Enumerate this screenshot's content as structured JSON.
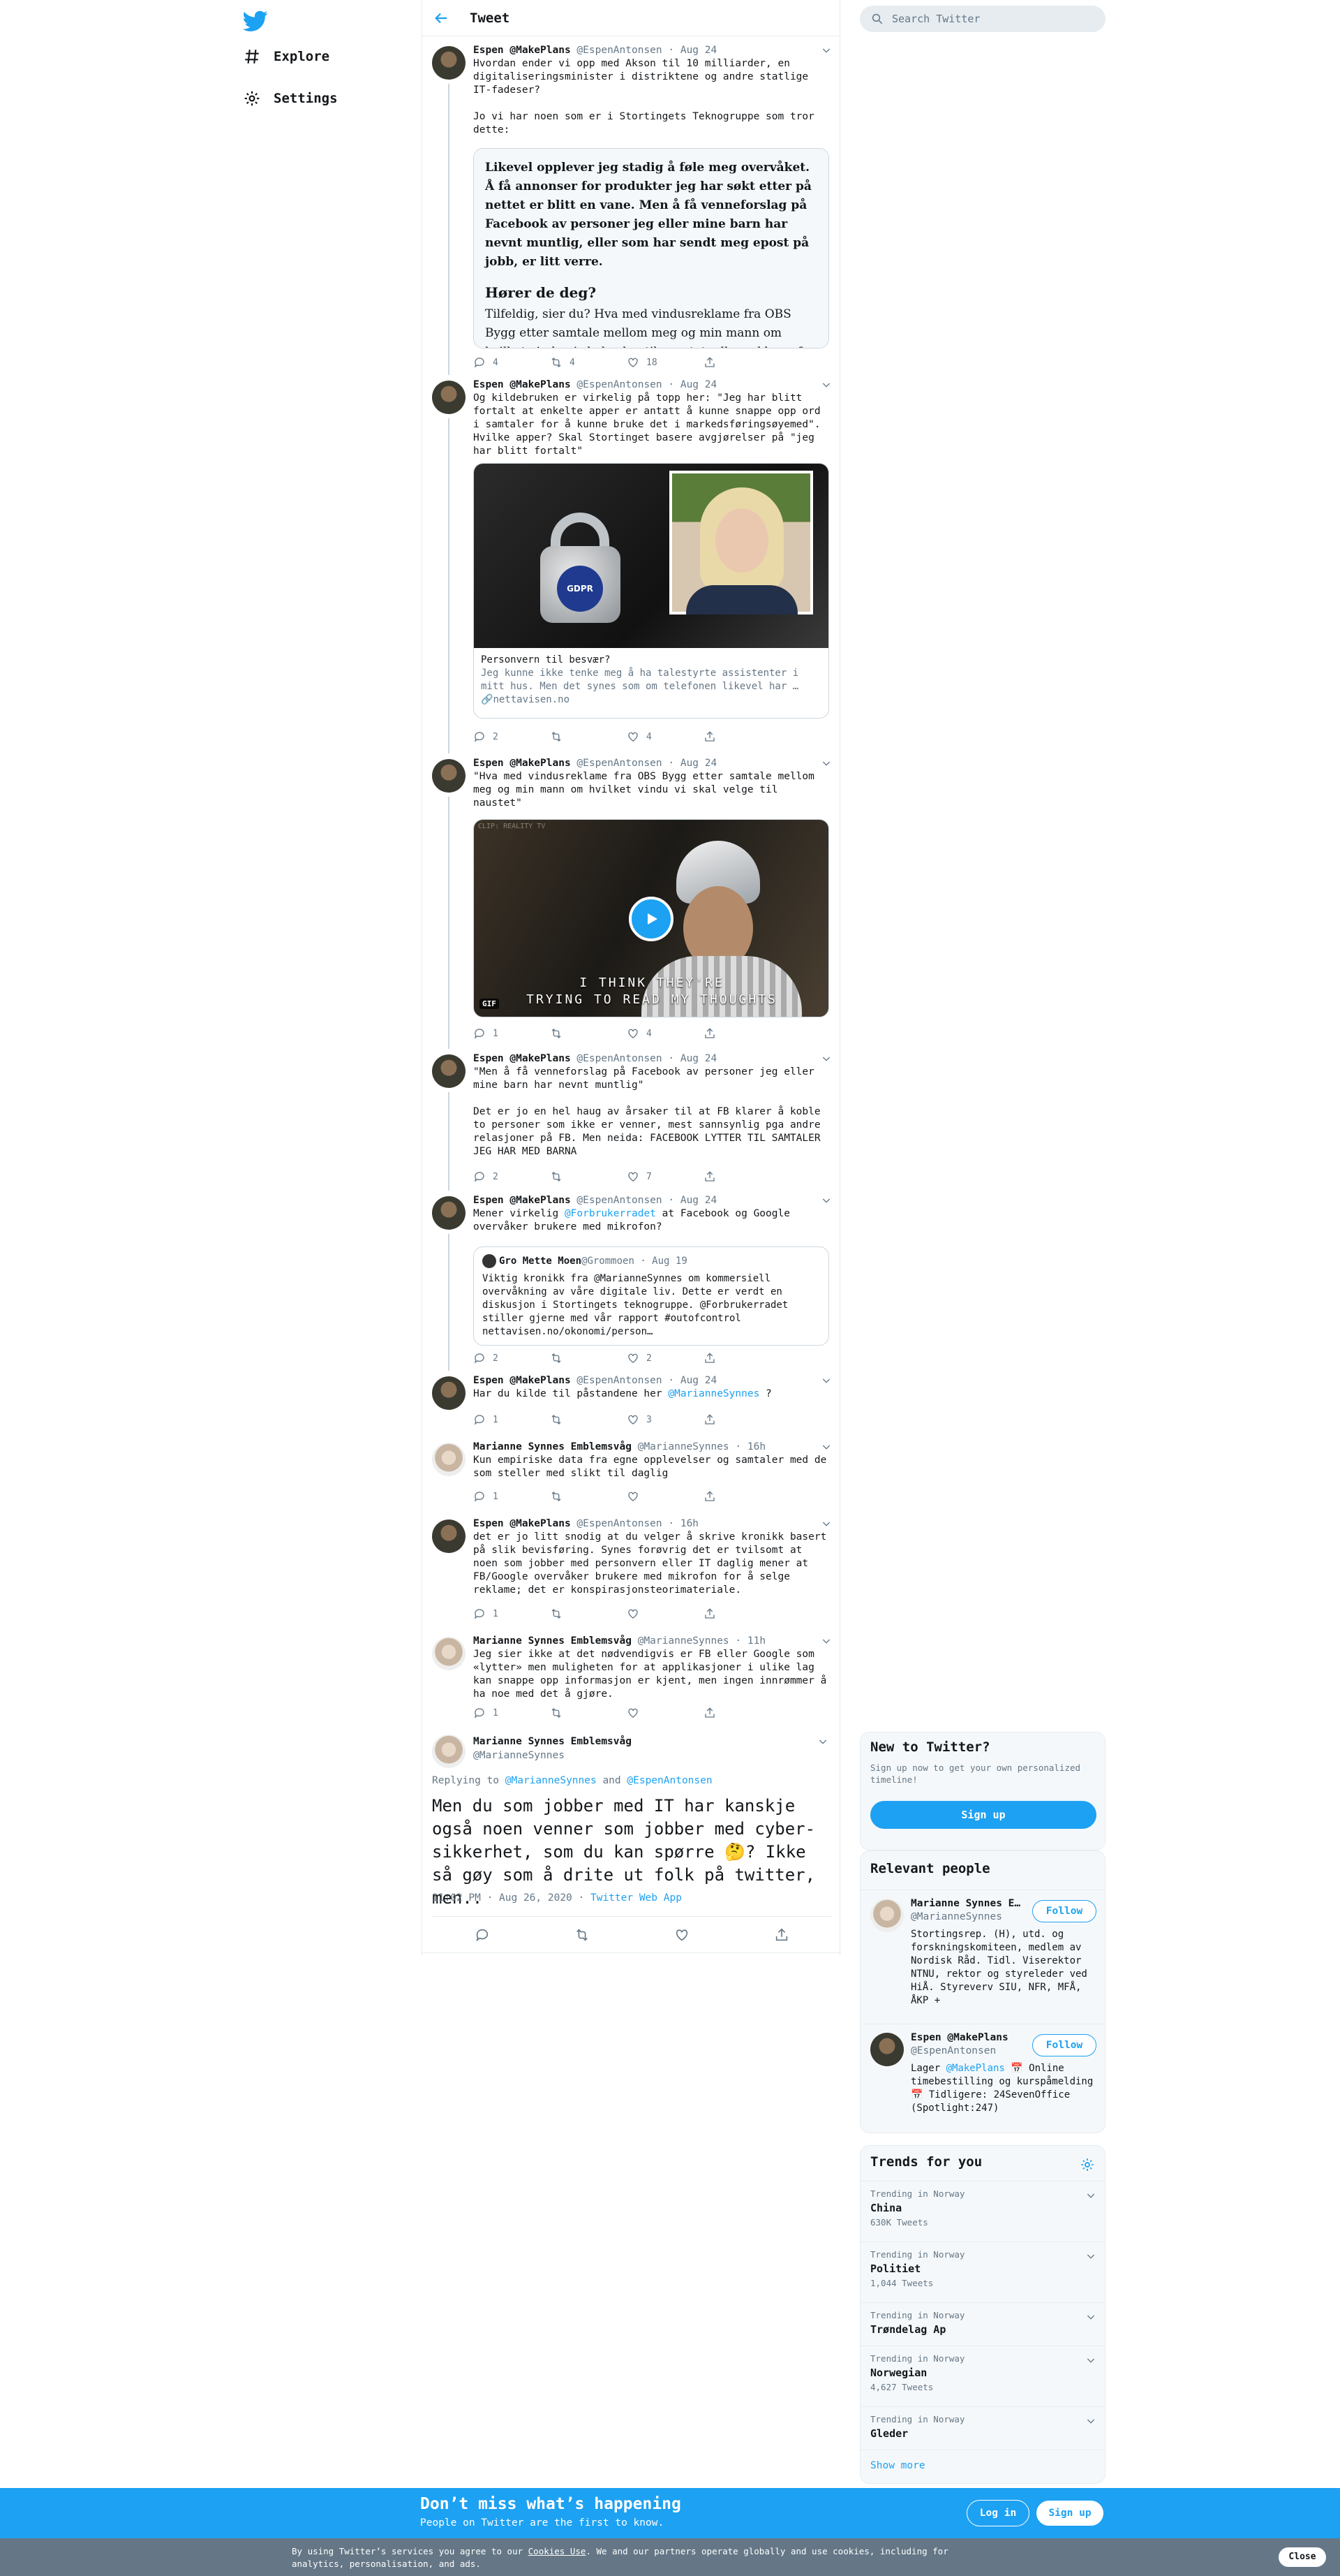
{
  "nav": {
    "explore": "Explore",
    "settings": "Settings"
  },
  "header": {
    "title": "Tweet"
  },
  "search": {
    "placeholder": "Search Twitter"
  },
  "tweets": [
    {
      "name": "Espen @MakePlans",
      "handle": "@EspenAntonsen",
      "time": "· Aug 24",
      "text": "Hvordan ender vi opp med Akson til 10 milliarder, en digitaliseringsminister i distriktene og andre statlige IT-fadeser?\n\nJo vi har noen som er i Stortingets Teknogruppe som tror dette:",
      "article_bold": "Likevel opplever jeg stadig å føle meg overvåket. Å få annonser for produkter jeg har søkt etter på nettet er blitt en vane. Men å få venneforslag på Facebook av personer jeg eller mine barn har nevnt muntlig, eller som har sendt meg epost på jobb, er litt verre.",
      "article_heading": "Hører de deg?",
      "article_text": "Tilfeldig, sier du? Hva med vindusreklame fra OBS Bygg etter samtale mellom meg og min mann om hvilket vindu vi skal velge til naustet, eller reklame for Disney når jeg",
      "replies": "4",
      "retweets": "4",
      "likes": "18"
    },
    {
      "name": "Espen @MakePlans",
      "handle": "@EspenAntonsen",
      "time": "· Aug 24",
      "text": "Og kildebruken er virkelig på topp her: \"Jeg har blitt fortalt at enkelte apper er antatt å kunne snappe opp ord i samtaler for å kunne bruke det i markedsføringsøyemed\". Hvilke apper? Skal Stortinget basere avgjørelser på \"jeg har blitt fortalt\"",
      "card_title": "Personvern til besvær?",
      "card_desc": "Jeg kunne ikke tenke meg å ha talestyrte assistenter i mitt hus. Men det synes som om telefonen likevel har …",
      "card_domain": "nettavisen.no",
      "card_badge": "GDPR",
      "replies": "2",
      "retweets": "",
      "likes": "4"
    },
    {
      "name": "Espen @MakePlans",
      "handle": "@EspenAntonsen",
      "time": "· Aug 24",
      "text": "\"Hva med vindusreklame fra OBS Bygg etter samtale mellom meg og min mann om hvilket vindu vi skal velge til naustet\"",
      "gif_caption_1": "I THINK THEY'RE",
      "gif_caption_2": "TRYING TO READ MY THOUGHTS",
      "gif_badge": "GIF",
      "gif_watermark": "CLIP: REALITY TV",
      "replies": "1",
      "retweets": "",
      "likes": "4"
    },
    {
      "name": "Espen @MakePlans",
      "handle": "@EspenAntonsen",
      "time": "· Aug 24",
      "text": "\"Men å få venneforslag på Facebook av personer jeg eller mine barn har nevnt muntlig\"\n\nDet er jo en hel haug av årsaker til at FB klarer å koble to personer som ikke er venner, mest sannsynlig pga andre relasjoner på FB. Men neida: FACEBOOK LYTTER TIL SAMTALER JEG HAR MED BARNA",
      "replies": "2",
      "retweets": "",
      "likes": "7"
    },
    {
      "name": "Espen @MakePlans",
      "handle": "@EspenAntonsen",
      "time": "· Aug 24",
      "text_pre": "Mener virkelig ",
      "mention": "@Forbrukerradet",
      "text_post": " at Facebook og Google overvåker brukere med mikrofon?",
      "quote_name": "Gro Mette Moen",
      "quote_handle": "@Grommoen",
      "quote_time": "· Aug 19",
      "quote_text": "Viktig kronikk fra @MarianneSynnes om kommersiell overvåkning av våre digitale liv. Dette er verdt en diskusjon i Stortingets teknogruppe. @Forbrukerradet stiller gjerne med vår rapport #outofcontrol nettavisen.no/okonomi/person…",
      "replies": "2",
      "retweets": "",
      "likes": "2"
    },
    {
      "name": "Espen @MakePlans",
      "handle": "@EspenAntonsen",
      "time": "· Aug 24",
      "text_pre": "Har du kilde til påstandene her ",
      "mention": "@MarianneSynnes",
      "text_post": " ?",
      "replies": "1",
      "retweets": "",
      "likes": "3"
    },
    {
      "name": "Marianne Synnes Emblemsvåg",
      "handle": "@MarianneSynnes",
      "time": "· 16h",
      "text": "Kun empiriske data fra egne opplevelser og samtaler med de som steller med slikt til daglig",
      "replies": "1",
      "retweets": "",
      "likes": ""
    },
    {
      "name": "Espen @MakePlans",
      "handle": "@EspenAntonsen",
      "time": "· 16h",
      "text": "det er jo litt snodig at du velger å skrive kronikk basert på slik bevisføring. Synes forøvrig det er tvilsomt at noen som jobber med personvern eller IT daglig mener at FB/Google overvåker brukere med mikrofon for å selge reklame; det er konspirasjonsteorimateriale.",
      "replies": "1",
      "retweets": "",
      "likes": ""
    },
    {
      "name": "Marianne Synnes Emblemsvåg",
      "handle": "@MarianneSynnes",
      "time": "· 11h",
      "text": "Jeg sier ikke at det nødvendigvis er FB eller Google som «lytter» men muligheten for at applikasjoner i ulike lag kan snappe opp informasjon er kjent, men ingen innrømmer å ha noe med det å gjøre.",
      "replies": "1",
      "retweets": "",
      "likes": ""
    }
  ],
  "focused": {
    "name": "Marianne Synnes Emblemsvåg",
    "handle": "@MarianneSynnes",
    "replying_prefix": "Replying to ",
    "replying_1": "@MarianneSynnes",
    "replying_and": " and ",
    "replying_2": "@EspenAntonsen",
    "text": "Men du som jobber med IT har kanskje også noen venner som jobber med cyber-sikkerhet, som du kan spørre 🤔? Ikke så gøy som å drite ut folk på twitter, men..",
    "timestamp": "11:02 PM · Aug 26, 2020 · ",
    "source": "Twitter Web App"
  },
  "new_to_twitter": {
    "title": "New to Twitter?",
    "desc": "Sign up now to get your own personalized timeline!",
    "button": "Sign up"
  },
  "relevant": {
    "title": "Relevant people",
    "people": [
      {
        "name": "Marianne Synnes E…",
        "handle": "@MarianneSynnes",
        "follow": "Follow",
        "bio": "Stortingsrep. (H), utd. og forskningskomiteen, medlem av Nordisk Råd. Tidl. Viserektor NTNU, rektor og styreleder ved HiÅ. Styreverv SIU, NFR, MFÅ, ÅKP +"
      },
      {
        "name": "Espen @MakePlans",
        "handle": "@EspenAntonsen",
        "follow": "Follow",
        "bio_pre": "Lager ",
        "bio_mention": "@MakePlans",
        "bio_post": " 📅 Online timebestilling og kurspåmelding 📅 Tidligere: 24SevenOffice (Spotlight:247)"
      }
    ]
  },
  "trends": {
    "title": "Trends for you",
    "items": [
      {
        "context": "Trending in Norway",
        "name": "China",
        "count": "630K Tweets"
      },
      {
        "context": "Trending in Norway",
        "name": "Politiet",
        "count": "1,044 Tweets"
      },
      {
        "context": "Trending in Norway",
        "name": "Trøndelag Ap",
        "count": ""
      },
      {
        "context": "Trending in Norway",
        "name": "Norwegian",
        "count": "4,627 Tweets"
      },
      {
        "context": "Trending in Norway",
        "name": "Gleder",
        "count": ""
      }
    ],
    "show_more": "Show more"
  },
  "signup_bar": {
    "title": "Don’t miss what’s happening",
    "subtitle": "People on Twitter are the first to know.",
    "login": "Log in",
    "signup": "Sign up"
  },
  "cookie_bar": {
    "text_pre": "By using Twitter’s services you agree to our ",
    "link": "Cookies Use",
    "text_post": ". We and our partners operate globally and use cookies, including for analytics, personalisation, and ads.",
    "close": "Close"
  },
  "colors": {
    "accent": "#1da1f2",
    "text": "#14171a",
    "muted": "#657786",
    "border": "#e6ecf0"
  }
}
